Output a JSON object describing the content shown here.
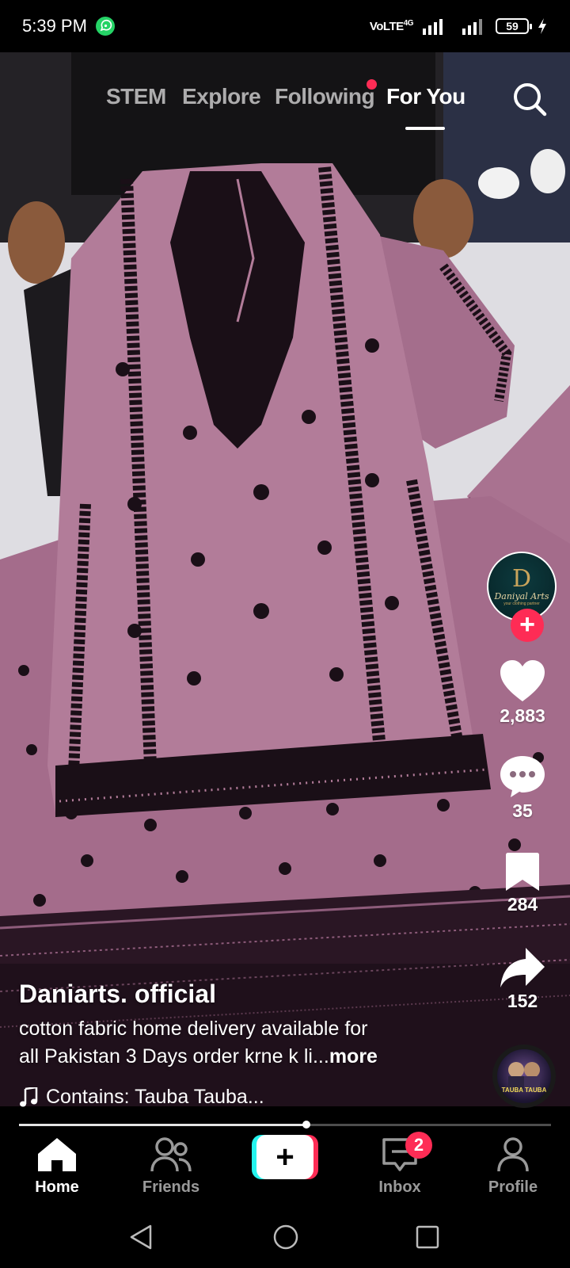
{
  "status_bar": {
    "time": "5:39 PM",
    "network": "VoLTE",
    "network_type": "4G",
    "battery": "59",
    "icons": [
      "whatsapp-icon",
      "signal-icon",
      "battery-icon",
      "charging-icon"
    ]
  },
  "top_tabs": {
    "items": [
      "STEM",
      "Explore",
      "Following",
      "For You"
    ],
    "active": "For You",
    "notification_dot_on": "Following"
  },
  "profile": {
    "avatar_initial": "D",
    "avatar_brand": "Daniyal Arts",
    "avatar_tagline": "your clothing partner"
  },
  "actions": {
    "likes": "2,883",
    "comments": "35",
    "saves": "284",
    "shares": "152"
  },
  "caption": {
    "username": "Daniarts. official",
    "description_line1": "cotton fabric home delivery available for",
    "description_line2": "all Pakistan 3 Days order krne k li...",
    "more": "more",
    "music": "Contains: Tauba Tauba...",
    "disc_text": "TAUBA TAUBA"
  },
  "playback": {
    "progress": 0.54
  },
  "bottom_nav": {
    "home": "Home",
    "friends": "Friends",
    "inbox": "Inbox",
    "profile": "Profile",
    "inbox_badge": "2",
    "active": "Home"
  },
  "colors": {
    "accent": "#fe2c55",
    "accent_cyan": "#25f4ee",
    "fabric": "#b07a98",
    "embroidery": "#1a0f17"
  }
}
